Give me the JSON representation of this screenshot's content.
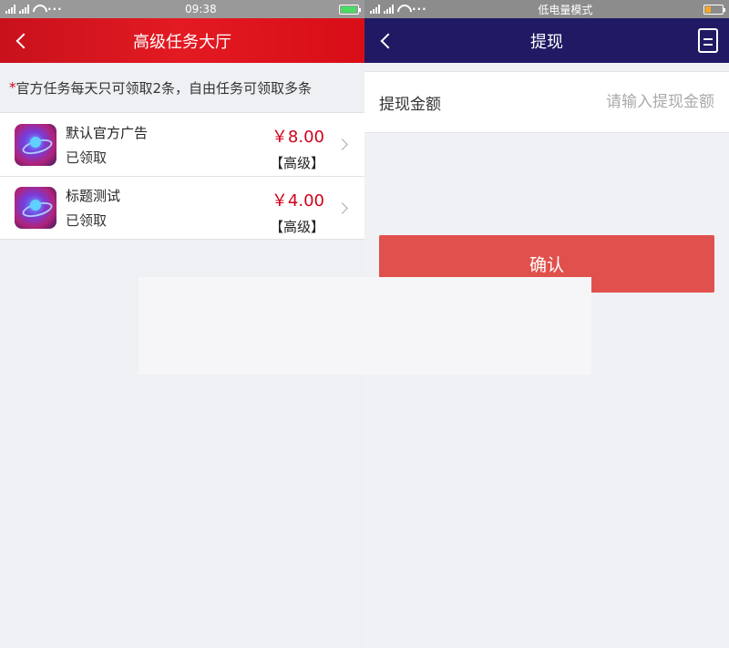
{
  "left": {
    "statusbar": {
      "time": "09:38",
      "dots": "···"
    },
    "navbar": {
      "title": "高级任务大厅"
    },
    "notice": {
      "star": "*",
      "text": "官方任务每天只可领取2条，自由任务可领取多条"
    },
    "tasks": [
      {
        "title": "默认官方广告",
        "status": "已领取",
        "price": "￥8.00",
        "level": "【高级】"
      },
      {
        "title": "标题测试",
        "status": "已领取",
        "price": "￥4.00",
        "level": "【高级】"
      }
    ]
  },
  "right": {
    "statusbar": {
      "mode": "低电量模式",
      "dots": "···"
    },
    "navbar": {
      "title": "提现"
    },
    "form": {
      "amount_label": "提现金额",
      "amount_placeholder": "请输入提现金额",
      "amount_value": ""
    },
    "confirm_label": "确认"
  },
  "colors": {
    "left_nav": "#d80d17",
    "right_nav": "#1f1a63",
    "price": "#d0021b",
    "confirm": "#e0514d"
  },
  "icons": [
    "back-chevron-icon",
    "document-icon",
    "task-app-icon",
    "chevron-right-icon",
    "signal-icon",
    "wifi-icon",
    "battery-icon"
  ]
}
